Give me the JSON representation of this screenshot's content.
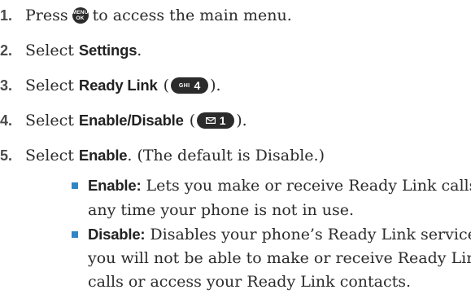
{
  "steps": [
    {
      "num": "1.",
      "pre": "Press",
      "post": "to access the main menu.",
      "key": {
        "icon": "menu-ok-key",
        "top": "MENU",
        "bottom": "OK"
      }
    },
    {
      "num": "2.",
      "pre": "Select",
      "bold": "Settings",
      "post": "."
    },
    {
      "num": "3.",
      "pre": "Select",
      "bold": "Ready Link",
      "paren_open": "(",
      "paren_close": ").",
      "key": {
        "icon": "ghi-4-key",
        "small": "GHI",
        "digit": "4"
      }
    },
    {
      "num": "4.",
      "pre": "Select",
      "bold": "Enable/Disable",
      "paren_open": "(",
      "paren_close": ").",
      "key": {
        "icon": "envelope-1-key",
        "digit": "1"
      }
    },
    {
      "num": "5.",
      "pre": "Select",
      "bold": "Enable",
      "post": ". (The default is Disable.)"
    }
  ],
  "bullets": [
    {
      "label": "Enable:",
      "lines": [
        "Lets you make or receive Ready Link calls",
        "any time your phone is not in use."
      ]
    },
    {
      "label": "Disable:",
      "lines": [
        "Disables your phone’s Ready Link service;",
        "you will not be able to make or receive Ready Link",
        "calls or access your Ready Link contacts."
      ]
    }
  ],
  "colors": {
    "bullet": "#2e86c6",
    "key_bg": "#2b2b2b",
    "text": "#2b2b2b"
  }
}
